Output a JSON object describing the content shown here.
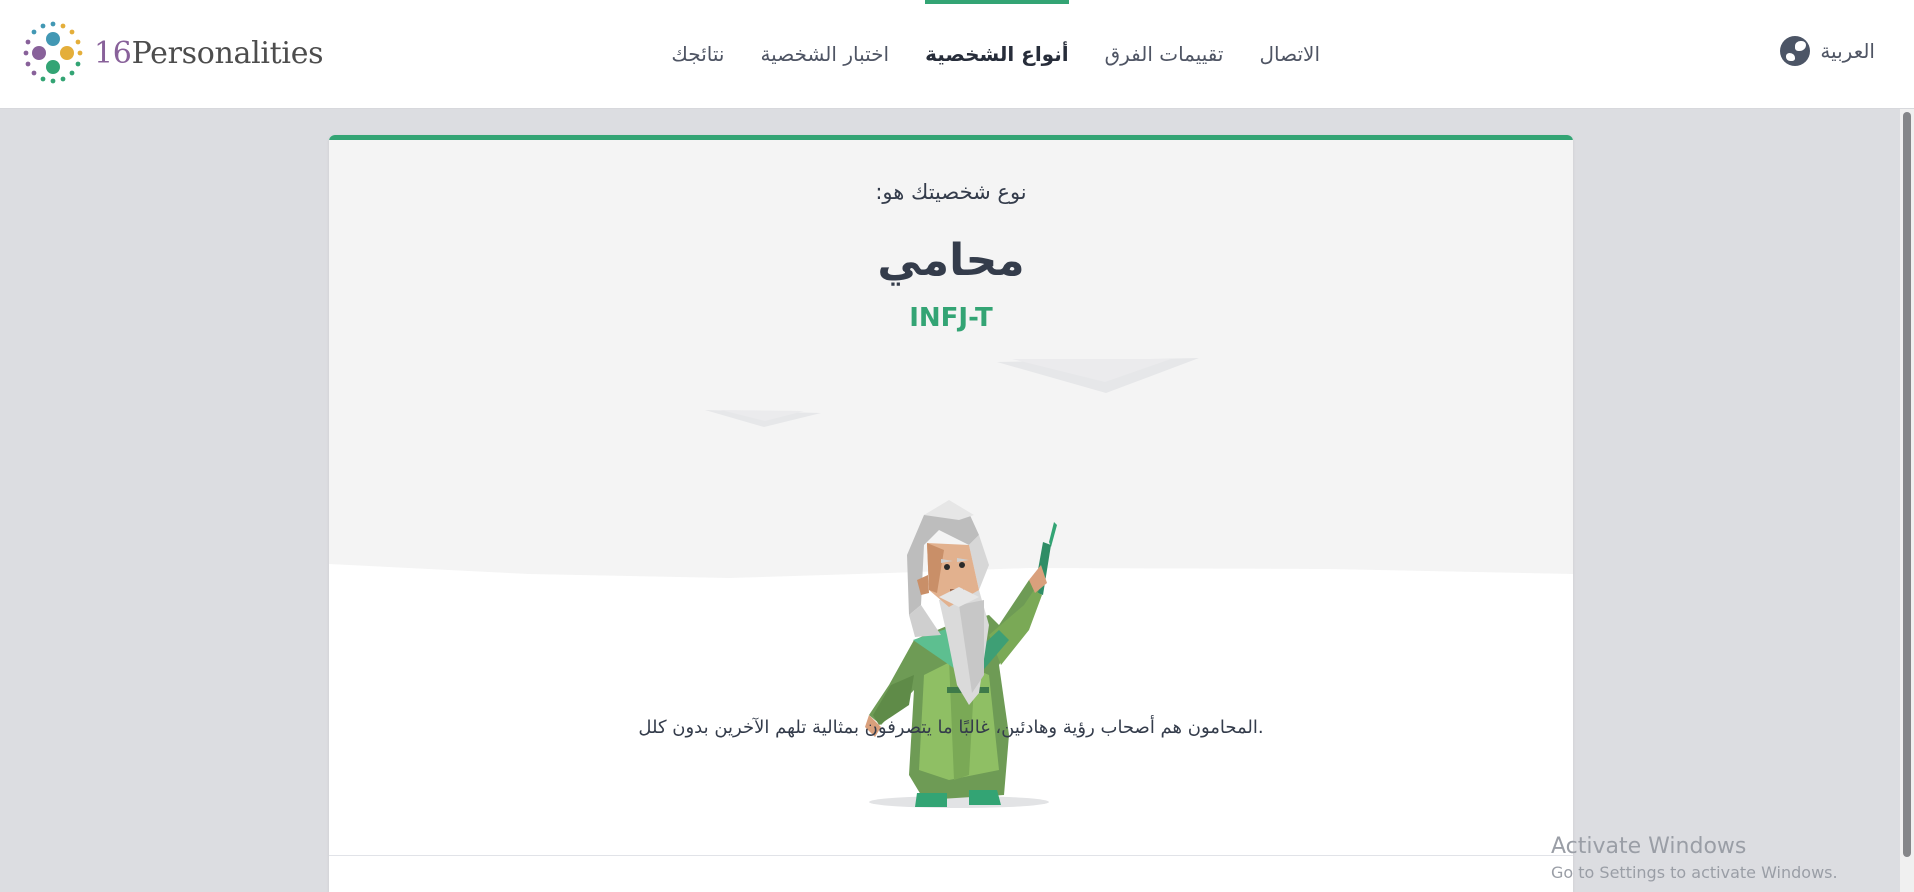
{
  "brand": {
    "num": "16",
    "name": "Personalities"
  },
  "nav": {
    "items": [
      {
        "label": "الاتصال",
        "active": false
      },
      {
        "label": "تقييمات الفرق",
        "active": false
      },
      {
        "label": "أنواع الشخصية",
        "active": true
      },
      {
        "label": "اختبار الشخصية",
        "active": false
      },
      {
        "label": "نتائجك",
        "active": false
      }
    ],
    "language": "العربية"
  },
  "result": {
    "intro": "نوع شخصيتك هو:",
    "type_name": "محامي",
    "type_code": "INFJ-T",
    "description": "المحامون هم أصحاب رؤية وهادئين، غالبًا ما يتصرفون بمثالية تلهم الآخرين بدون كلل."
  },
  "watermark": {
    "title": "Activate Windows",
    "subtitle": "Go to Settings to activate Windows."
  },
  "colors": {
    "accent": "#33a474",
    "brand_purple": "#88619a",
    "text": "#343c4b",
    "page_bg": "#dcdde1"
  },
  "icons": {
    "language": "globe-icon",
    "illustration": "advocate-character-illustration"
  }
}
